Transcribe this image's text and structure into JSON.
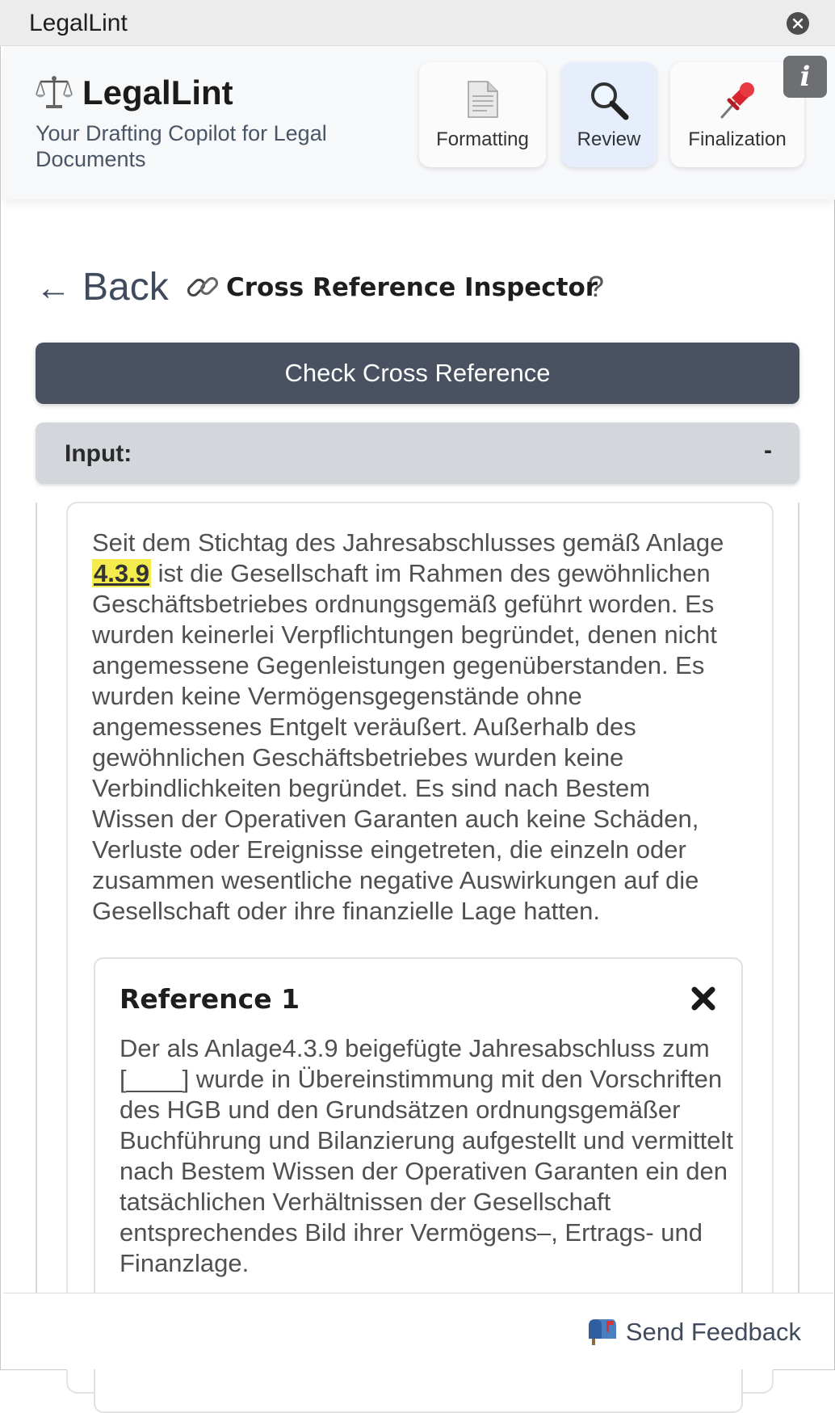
{
  "window": {
    "title": "LegalLint"
  },
  "header": {
    "brand": "LegalLint",
    "tagline": "Your Drafting Copilot for Legal Documents",
    "nav": [
      {
        "label": "Formatting",
        "icon": "document-icon"
      },
      {
        "label": "Review",
        "icon": "magnifier-icon"
      },
      {
        "label": "Finalization",
        "icon": "pushpin-icon"
      }
    ],
    "info_label": "i"
  },
  "toolbar": {
    "back_label": "Back",
    "back_arrow": "←",
    "tool_title": "Cross Reference Inspector",
    "help_label": "?"
  },
  "check_button": "Check Cross Reference",
  "input_section": {
    "label": "Input:",
    "collapse_label": "-"
  },
  "input_text": {
    "before": "Seit dem Stichtag des Jahresabschlusses gemäß Anlage ",
    "reference": "4.3.9",
    "after": " ist die Gesellschaft im Rahmen des gewöhnlichen Geschäftsbetriebes ordnungsgemäß geführt worden. Es wurden keinerlei Verpflichtungen begründet, denen nicht angemessene Gegenleistungen gegenüberstanden. Es wurden keine Vermögensgegenstände ohne angemessenes Entgelt veräußert. Außerhalb des gewöhnlichen Geschäftsbetriebes wurden keine Verbindlichkeiten begründet. Es sind nach Bestem Wissen der Operativen Garanten auch keine Schäden, Verluste oder Ereignisse eingetreten, die einzeln oder zusammen wesentliche negative Auswirkungen auf die Gesellschaft oder ihre finanzielle Lage hatten."
  },
  "references": [
    {
      "title": "Reference 1",
      "text": "Der als Anlage4.3.9 beigefügte Jahresabschluss zum [____] wurde in Übereinstimmung mit den Vorschriften des HGB und den Grundsätzen ordnungsgemäßer Buchführung und Bilanzierung aufgestellt und vermittelt nach Bestem Wissen der Operativen Garanten ein den tatsächlichen Verhältnissen der Gesellschaft entsprechendes Bild ihrer Vermögens–, Ertrags- und Finanzlage."
    }
  ],
  "footer": {
    "feedback_label": "Send Feedback"
  },
  "colors": {
    "primary_button": "#4a5261",
    "active_tab": "#e6edfb",
    "highlight": "#f4ec4f"
  }
}
